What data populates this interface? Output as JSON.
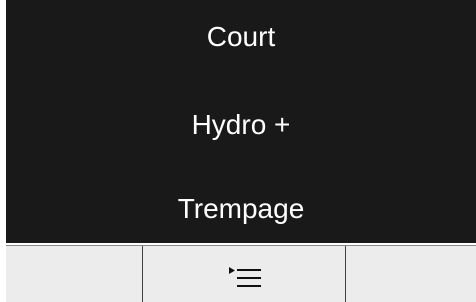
{
  "display": {
    "options": [
      {
        "label": "Court"
      },
      {
        "label": "Hydro +"
      },
      {
        "label": "Trempage"
      }
    ]
  },
  "softkeys": {
    "left": {
      "label": ""
    },
    "middle": {
      "icon": "menu-list-icon"
    },
    "right": {
      "label": ""
    }
  }
}
